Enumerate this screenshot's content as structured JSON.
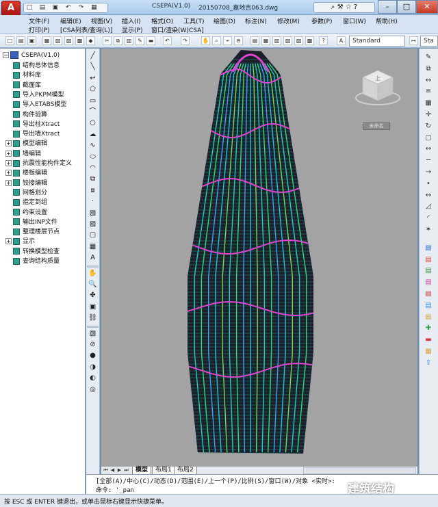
{
  "window": {
    "title": "CSEPA(V1.0)",
    "filename": "20150708_嘉地吉063.dwg",
    "app_logo": "A"
  },
  "quick_access": {
    "icons": [
      "new-icon",
      "open-icon",
      "save-icon",
      "undo-icon",
      "redo-icon",
      "print-icon",
      "dropdown-icon"
    ],
    "glyphs": [
      "□",
      "▤",
      "▣",
      "↶",
      "↷",
      "▦",
      "▾"
    ]
  },
  "window_controls": {
    "minimize": "–",
    "maximize": "□",
    "close": "✕"
  },
  "menu": {
    "row1": [
      "文件(F)",
      "编辑(E)",
      "视图(V)",
      "插入(I)",
      "格式(O)",
      "工具(T)",
      "绘图(D)",
      "标注(N)",
      "修改(M)",
      "参数(P)",
      "窗口(W)",
      "帮助(H)"
    ],
    "row2": [
      "打印(P)",
      "[CSA列表/查询(L)]",
      "显示(P)",
      "窗口/渲染(W)CSA]"
    ]
  },
  "toolbar": {
    "text_style": "Standard",
    "text_style_right": "Sta"
  },
  "tree": {
    "root": "CSEPA(V1.0)",
    "items": [
      {
        "label": "结构总体信息",
        "expandable": false
      },
      {
        "label": "材料库",
        "expandable": false
      },
      {
        "label": "截面库",
        "expandable": false
      },
      {
        "label": "导入PKPM模型",
        "expandable": false
      },
      {
        "label": "导入ETABS模型",
        "expandable": false
      },
      {
        "label": "构件验算",
        "expandable": false
      },
      {
        "label": "导出柱Xtract",
        "expandable": false
      },
      {
        "label": "导出墙Xtract",
        "expandable": false
      },
      {
        "label": "模型编辑",
        "expandable": true
      },
      {
        "label": "墙编辑",
        "expandable": true
      },
      {
        "label": "抗震性能构件定义",
        "expandable": true
      },
      {
        "label": "楼板编辑",
        "expandable": true
      },
      {
        "label": "铰接编辑",
        "expandable": true
      },
      {
        "label": "网格划分",
        "expandable": false
      },
      {
        "label": "指定到组",
        "expandable": false
      },
      {
        "label": "约束设置",
        "expandable": false
      },
      {
        "label": "输出INP文件",
        "expandable": false
      },
      {
        "label": "整理楼层节点",
        "expandable": false
      },
      {
        "label": "显示",
        "expandable": true
      },
      {
        "label": "转换模型检查",
        "expandable": false
      },
      {
        "label": "查询结构质量",
        "expandable": false
      }
    ]
  },
  "left_toolbar": {
    "icons": [
      "line-icon",
      "construction-line-icon",
      "polyline-icon",
      "polygon-icon",
      "rectangle-icon",
      "arc-icon",
      "circle-icon",
      "revision-cloud-icon",
      "spline-icon",
      "ellipse-icon",
      "ellipse-arc-icon",
      "insert-block-icon",
      "make-block-icon",
      "point-icon",
      "hatch-icon",
      "gradient-icon",
      "region-icon",
      "table-icon",
      "multiline-text-icon",
      "pan-icon",
      "zoom-icon",
      "orbit-icon",
      "zoom-window-icon",
      "walk-icon",
      "layer-icon",
      "visual-style-icon",
      "sphere-icon",
      "material-icon",
      "render-icon",
      "properties-icon"
    ],
    "glyphs": [
      "╱",
      "╲",
      "↩",
      "⬠",
      "▭",
      "⌒",
      "○",
      "☁",
      "∿",
      "⬭",
      "◠",
      "⧉",
      "⧈",
      "·",
      "▧",
      "▨",
      "▢",
      "▦",
      "A",
      "✋",
      "🔍",
      "✤",
      "▣",
      "⛓",
      "▧",
      "⊘",
      "●",
      "◑",
      "◐",
      "◎"
    ]
  },
  "right_toolbar": {
    "icons": [
      "erase-icon",
      "copy-icon",
      "mirror-icon",
      "offset-icon",
      "array-icon",
      "move-icon",
      "rotate-icon",
      "scale-icon",
      "stretch-icon",
      "trim-icon",
      "extend-icon",
      "break-icon",
      "join-icon",
      "chamfer-icon",
      "fillet-icon",
      "explode-icon",
      "layer-state-icon",
      "csa-beam-icon",
      "csa-column-icon",
      "csa-wall-icon",
      "csa-slab-icon",
      "csa-brace-icon",
      "csa-grid-icon",
      "csa-add-icon",
      "csa-remove-icon",
      "csa-table-icon",
      "csa-export-icon"
    ],
    "glyphs": [
      "✎",
      "⧉",
      "↔",
      "≡",
      "▦",
      "✛",
      "↻",
      "▢",
      "↔",
      "─",
      "→",
      "•",
      "↔",
      "◿",
      "◜",
      "✶",
      "▤",
      "▤",
      "▤",
      "▤",
      "▤",
      "▤",
      "▤",
      "✚",
      "▬",
      "▦",
      "⇧"
    ]
  },
  "viewcube": {
    "top": "上",
    "named_view": "未命名"
  },
  "layout_tabs": [
    "模型",
    "布局1",
    "布局2"
  ],
  "command": {
    "line1": "[全部(A)/中心(C)/动态(D)/范围(E)/上一个(P)/比例(S)/窗口(W)/对象 <实时>:",
    "line2": "命令: '_pan"
  },
  "status": "按 ESC 或 ENTER 键退出，或单击鼠标右键显示快捷菜单。",
  "watermark": "建筑结构"
}
